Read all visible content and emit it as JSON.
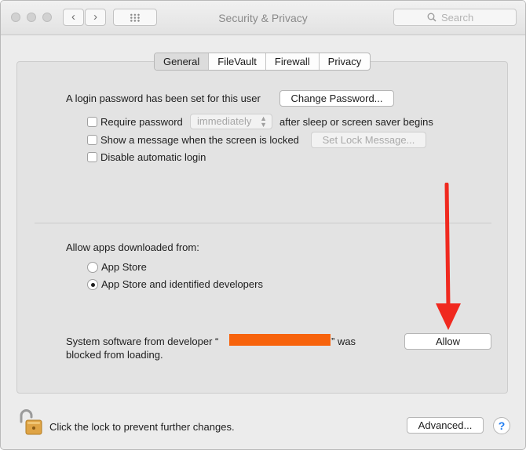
{
  "window": {
    "title": "Security & Privacy",
    "back_icon": "‹",
    "forward_icon": "›",
    "search_placeholder": "Search"
  },
  "tabs": [
    {
      "label": "General",
      "selected": true
    },
    {
      "label": "FileVault",
      "selected": false
    },
    {
      "label": "Firewall",
      "selected": false
    },
    {
      "label": "Privacy",
      "selected": false
    }
  ],
  "general": {
    "login_text": "A login password has been set for this user",
    "change_password_button": "Change Password...",
    "require_password_label": "Require password",
    "require_password_checked": false,
    "require_password_value": "immediately",
    "after_sleep_text": "after sleep or screen saver begins",
    "show_message_label": "Show a message when the screen is locked",
    "show_message_checked": false,
    "set_lock_message_button": "Set Lock Message...",
    "disable_auto_login_label": "Disable automatic login",
    "disable_auto_login_checked": false
  },
  "allow_apps": {
    "heading": "Allow apps downloaded from:",
    "options": [
      {
        "label": "App Store",
        "selected": false
      },
      {
        "label": "App Store and identified developers",
        "selected": true
      }
    ]
  },
  "blocked": {
    "text_before": "System software from developer “",
    "text_after": "” was",
    "text_line2": "blocked from loading.",
    "allow_button": "Allow"
  },
  "annotation": {
    "arrow_color": "#f0291f",
    "redaction_color": "#f7630c"
  },
  "footer": {
    "lock_text": "Click the lock to prevent further changes.",
    "advanced_button": "Advanced...",
    "help_label": "?"
  }
}
